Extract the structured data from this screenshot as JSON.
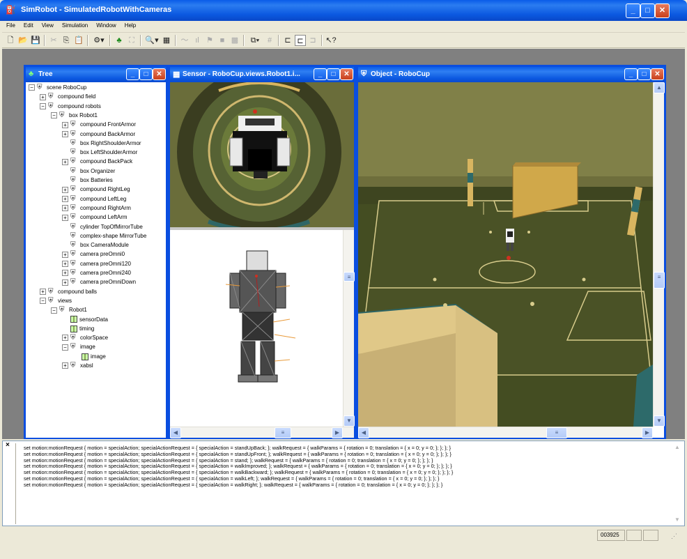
{
  "window": {
    "title": "SimRobot - SimulatedRobotWithCameras"
  },
  "menu": [
    "File",
    "Edit",
    "View",
    "Simulation",
    "Window",
    "Help"
  ],
  "tree_pane": {
    "title": "Tree",
    "nodes": [
      {
        "label": "scene RoboCup",
        "depth": 0,
        "exp": "−"
      },
      {
        "label": "compound field",
        "depth": 1,
        "exp": "+"
      },
      {
        "label": "compound robots",
        "depth": 1,
        "exp": "−"
      },
      {
        "label": "box Robot1",
        "depth": 2,
        "exp": "−"
      },
      {
        "label": "compound FrontArmor",
        "depth": 3,
        "exp": "+"
      },
      {
        "label": "compound BackArmor",
        "depth": 3,
        "exp": "+"
      },
      {
        "label": "box RightShoulderArmor",
        "depth": 3,
        "exp": ""
      },
      {
        "label": "box LeftShoulderArmor",
        "depth": 3,
        "exp": ""
      },
      {
        "label": "compound BackPack",
        "depth": 3,
        "exp": "+"
      },
      {
        "label": "box Organizer",
        "depth": 3,
        "exp": ""
      },
      {
        "label": "box Batteries",
        "depth": 3,
        "exp": ""
      },
      {
        "label": "compound RightLeg",
        "depth": 3,
        "exp": "+"
      },
      {
        "label": "compound LeftLeg",
        "depth": 3,
        "exp": "+"
      },
      {
        "label": "compound RightArm",
        "depth": 3,
        "exp": "+"
      },
      {
        "label": "compound LeftArm",
        "depth": 3,
        "exp": "+"
      },
      {
        "label": "cylinder TopOfMirrorTube",
        "depth": 3,
        "exp": ""
      },
      {
        "label": "complex-shape MirrorTube",
        "depth": 3,
        "exp": ""
      },
      {
        "label": "box CameraModule",
        "depth": 3,
        "exp": ""
      },
      {
        "label": "camera preOmni0",
        "depth": 3,
        "exp": "+"
      },
      {
        "label": "camera preOmni120",
        "depth": 3,
        "exp": "+"
      },
      {
        "label": "camera preOmni240",
        "depth": 3,
        "exp": "+"
      },
      {
        "label": "camera preOmniDown",
        "depth": 3,
        "exp": "+"
      },
      {
        "label": "compound balls",
        "depth": 1,
        "exp": "+"
      },
      {
        "label": "views",
        "depth": 1,
        "exp": "−"
      },
      {
        "label": "Robot1",
        "depth": 2,
        "exp": "−"
      },
      {
        "label": "sensorData",
        "depth": 3,
        "exp": "",
        "icon": "img"
      },
      {
        "label": "timing",
        "depth": 3,
        "exp": "",
        "icon": "img"
      },
      {
        "label": "colorSpace",
        "depth": 3,
        "exp": "+"
      },
      {
        "label": "image",
        "depth": 3,
        "exp": "−"
      },
      {
        "label": "image",
        "depth": 4,
        "exp": "",
        "icon": "img"
      },
      {
        "label": "xabsl",
        "depth": 3,
        "exp": "+"
      }
    ]
  },
  "sensor_pane": {
    "title": "Sensor - RoboCup.views.Robot1.i..."
  },
  "object_pane": {
    "title": "Object - RoboCup"
  },
  "console": {
    "lines": [
      "set motion:motionRequest { motion = specialAction; specialActionRequest = { specialAction = standUpBack; }; walkRequest = { walkParams = { rotation = 0; translation = { x = 0; y = 0; }; }; }; }",
      "set motion:motionRequest { motion = specialAction; specialActionRequest = { specialAction = standUpFront; }; walkRequest = { walkParams = { rotation = 0; translation = { x = 0; y = 0; }; }; }; }",
      "set motion:motionRequest { motion = specialAction; specialActionRequest = { specialAction = stand; }; walkRequest = { walkParams = { rotation = 0; translation = { x = 0; y = 0; }; }; }; }",
      "set motion:motionRequest { motion = specialAction; specialActionRequest = { specialAction = walkImproved; }; walkRequest = { walkParams = { rotation = 0; translation = { x = 0; y = 0; }; }; }; }",
      "set motion:motionRequest { motion = specialAction; specialActionRequest = { specialAction = walkBackward; }; walkRequest = { walkParams = { rotation = 0; translation = { x = 0; y = 0; }; }; }; }",
      "set motion:motionRequest { motion = specialAction; specialActionRequest = { specialAction = walkLeft; }; walkRequest = { walkParams = { rotation = 0; translation = { x = 0; y = 0; }; }; }; }",
      "set motion:motionRequest { motion = specialAction; specialActionRequest = { specialAction = walkRight; }; walkRequest = { walkParams = { rotation = 0; translation = { x = 0; y = 0; }; }; }; }"
    ],
    "close_glyph": "×"
  },
  "status": {
    "counter": "003925"
  },
  "colors": {
    "titlebar": "#0a5ce8",
    "field": "#4a5226",
    "field_lines": "#e0cf8a",
    "wall": "#d8c081",
    "goal_yellow": "#d0a84a"
  }
}
